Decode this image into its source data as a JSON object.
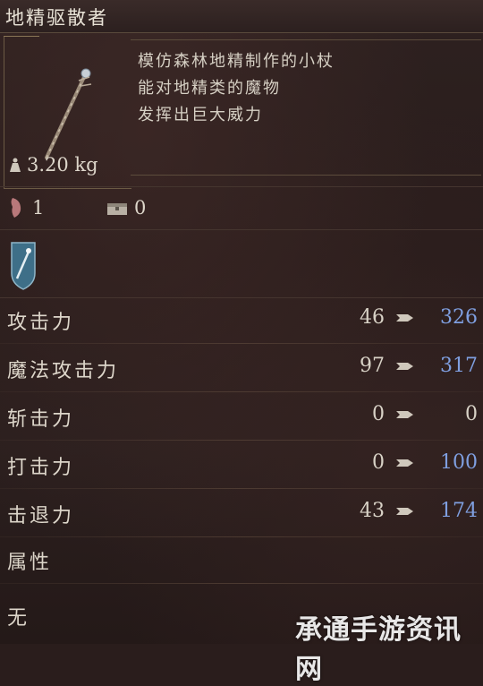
{
  "item": {
    "name": "地精驱散者",
    "description": [
      "模仿森林地精制作的小杖",
      "能对地精类的魔物",
      "发挥出巨大威力"
    ],
    "weight": "3.20 kg",
    "requirement_a": "1",
    "requirement_b": "0"
  },
  "stats": [
    {
      "label": "攻击力",
      "base": "46",
      "new": "326",
      "improved": true
    },
    {
      "label": "魔法攻击力",
      "base": "97",
      "new": "317",
      "improved": true
    },
    {
      "label": "斩击力",
      "base": "0",
      "new": "0",
      "improved": false
    },
    {
      "label": "打击力",
      "base": "0",
      "new": "100",
      "improved": true
    },
    {
      "label": "击退力",
      "base": "43",
      "new": "174",
      "improved": true
    }
  ],
  "attribute": {
    "label": "属性",
    "value": "无"
  },
  "watermark": "承通手游资讯网",
  "colors": {
    "improved": "#7f9fe0",
    "neutral": "#d8d2c6"
  }
}
